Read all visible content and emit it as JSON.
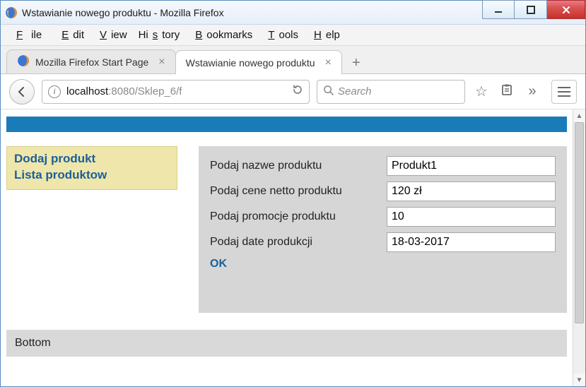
{
  "window": {
    "title": "Wstawianie nowego produktu - Mozilla Firefox"
  },
  "menubar": {
    "file": "File",
    "edit": "Edit",
    "view": "View",
    "history": "History",
    "bookmarks": "Bookmarks",
    "tools": "Tools",
    "help": "Help"
  },
  "tabs": {
    "tab1": "Mozilla Firefox Start Page",
    "tab2": "Wstawianie nowego produktu"
  },
  "nav": {
    "url_host": "localhost",
    "url_rest": ":8080/Sklep_6/f",
    "search_placeholder": "Search"
  },
  "sidebar": {
    "link1": "Dodaj produkt",
    "link2": "Lista produktow"
  },
  "form": {
    "label_name": "Podaj nazwe produktu",
    "label_price": "Podaj cene netto produktu",
    "label_promo": "Podaj promocje produktu",
    "label_date": "Podaj date produkcji",
    "value_name": "Produkt1",
    "value_price": "120 zł",
    "value_promo": "10",
    "value_date": "18-03-2017",
    "ok": "OK"
  },
  "footer": {
    "text": "Bottom"
  }
}
